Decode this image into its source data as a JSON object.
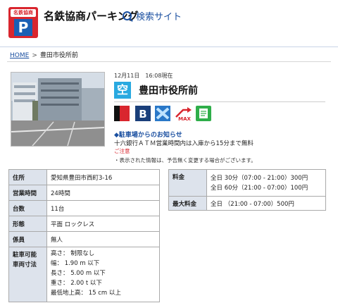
{
  "header": {
    "logo_top": "名鉄協商",
    "logo_letter": "P",
    "brand": "名鉄協商パーキング",
    "search_label": "検索サイト"
  },
  "breadcrumb": {
    "home": "HOME",
    "current": "豊田市役所前"
  },
  "status": {
    "date": "12月11日　16:08現在",
    "vacancy": "空"
  },
  "lot": {
    "name": "豊田市役所前"
  },
  "icons": [
    "card-icon",
    "b-card-icon",
    "x-icon",
    "max-gate-icon",
    "receipt-icon"
  ],
  "notice": {
    "heading": "◆駐車場からのお知らせ",
    "body": "十六銀行ＡＴＭ営業時間内は入庫から15分まで無料",
    "caution": "ご注意",
    "note": "・表示された情報は、予告無く変更する場合がございます。"
  },
  "info_table": [
    {
      "label": "住所",
      "value": [
        "愛知県豊田市西町3-16"
      ]
    },
    {
      "label": "営業時間",
      "value": [
        "24時間"
      ]
    },
    {
      "label": "台数",
      "value": [
        "11台"
      ]
    },
    {
      "label": "形態",
      "value": [
        "平面 ロックレス"
      ]
    },
    {
      "label": "係員",
      "value": [
        "無人"
      ]
    },
    {
      "label": [
        "駐車可能",
        "車両寸法"
      ],
      "value": [
        "高さ： 制限なし",
        "幅： 1.90 m 以下",
        "長さ： 5.00 m 以下",
        "重さ： 2.00 t 以下",
        "最低地上高： 15 cm 以上"
      ]
    }
  ],
  "price_table": [
    {
      "label": "料金",
      "value": [
        "全日 30分（07:00 - 21:00）300円",
        "全日 60分（21:00 - 07:00）100円"
      ]
    },
    {
      "label": "最大料金",
      "value": [
        "全日 （21:00 - 07:00）500円"
      ]
    }
  ],
  "colors": {
    "brand_red": "#d9262e",
    "brand_blue": "#1a4fa0",
    "vacant": "#29a9e0",
    "table_header": "#dde3ec"
  }
}
